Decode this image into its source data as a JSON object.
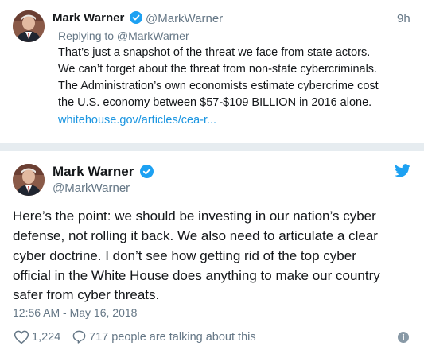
{
  "reply_tweet": {
    "author_name": "Mark Warner",
    "author_handle": "@MarkWarner",
    "time": "9h",
    "replying_to": "Replying to @MarkWarner",
    "text_lines": [
      "That’s just a snapshot of the threat we face from state actors.",
      "We can’t forget about the threat from non-state cybercriminals.",
      "The Administration’s own economists estimate cybercrime cost",
      "the U.S. economy between $57-$109 BILLION in 2016 alone."
    ],
    "link": "whitehouse.gov/articles/cea-r..."
  },
  "main_tweet": {
    "author_name": "Mark Warner",
    "author_handle": "@MarkWarner",
    "text_lines": [
      "Here’s the point: we should be investing in our nation’s cyber",
      "defense, not rolling it back.  We also need to articulate a clear",
      "cyber doctrine. I don’t see how getting rid of the top cyber",
      "official in the White House does anything to make our country",
      "safer from cyber threats."
    ],
    "timestamp": "12:56 AM - May 16, 2018",
    "likes": "1,224",
    "talking": "717 people are talking about this"
  },
  "colors": {
    "verified": "#1da1f2",
    "twitter_bird": "#1da1f2",
    "link": "#1b95e0",
    "secondary_text": "#657786",
    "divider": "#e6ecf0"
  },
  "icons": [
    "verified-badge-icon",
    "twitter-bird-icon",
    "heart-icon",
    "comment-bubble-icon",
    "info-icon"
  ]
}
